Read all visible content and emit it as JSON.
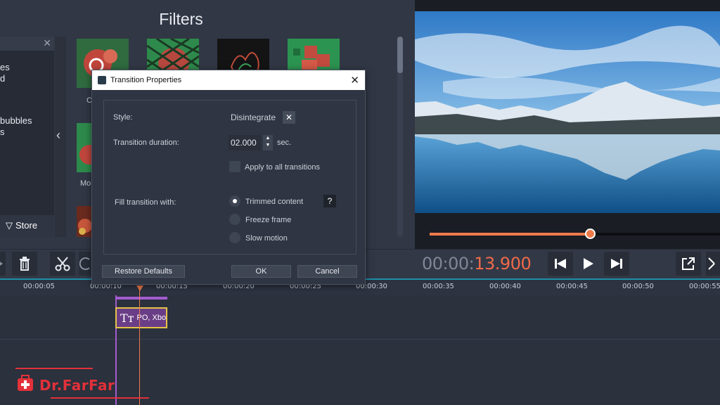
{
  "filters_panel": {
    "title": "Filters",
    "categories": [
      "es",
      "d",
      "bubbles",
      "s"
    ],
    "store_label": "Store",
    "thumb_labels": [
      "C",
      "Mo"
    ]
  },
  "dialog": {
    "title": "Transition Properties",
    "style_label": "Style:",
    "style_value": "Disintegrate",
    "duration_label": "Transition duration:",
    "duration_value": "02.000",
    "duration_unit": "sec.",
    "apply_all_label": "Apply to all transitions",
    "apply_all_checked": false,
    "fill_label": "Fill transition with:",
    "fill_options": [
      "Trimmed content",
      "Freeze frame",
      "Slow motion"
    ],
    "fill_selected": "Trimmed content",
    "help_label": "?",
    "restore_label": "Restore Defaults",
    "ok_label": "OK",
    "cancel_label": "Cancel"
  },
  "player": {
    "timecode_prefix": "00:00:",
    "timecode_seconds": "13.900",
    "progress": 0.55
  },
  "timeline": {
    "ticks": [
      "00:00:05",
      "00:00:10",
      "00:00:15",
      "00:00:20",
      "00:00:25",
      "00:00:30",
      "00:00:35",
      "00:00:40",
      "00:00:45",
      "00:00:50",
      "00:00:55"
    ],
    "title_clip_text": "PO, Xbo"
  },
  "watermark": {
    "text": "Dr.FarFar"
  },
  "colors": {
    "accent": "#ef7b4b",
    "clip": "#6a3e86",
    "timecode_hi": "#ef6a4a",
    "watermark": "#e2313a"
  }
}
